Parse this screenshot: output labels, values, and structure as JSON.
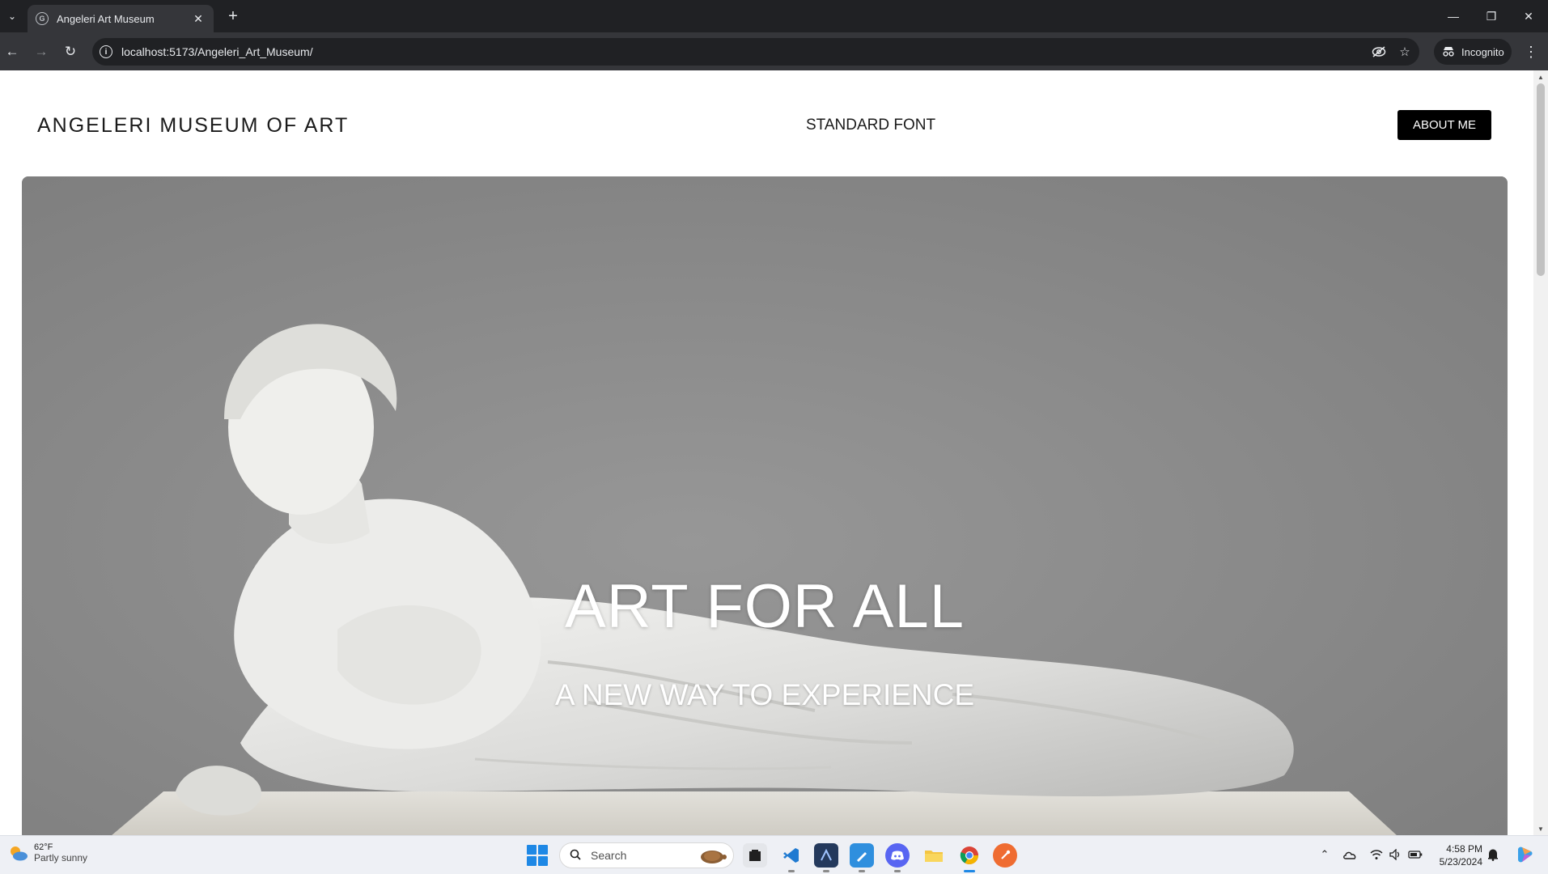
{
  "browser": {
    "tab": {
      "title": "Angeleri Art Museum",
      "close_glyph": "✕"
    },
    "new_tab_glyph": "+",
    "address": {
      "url": "localhost:5173/Angeleri_Art_Museum/"
    },
    "incognito_label": "Incognito",
    "window_controls": {
      "minimize": "—",
      "restore": "❐",
      "close": "✕"
    }
  },
  "site": {
    "brand": "ANGELERI MUSEUM OF ART",
    "font_toggle": "STANDARD FONT",
    "about_button": "ABOUT ME",
    "hero": {
      "title": "ART FOR ALL",
      "subtitle": "A NEW WAY TO EXPERIENCE"
    }
  },
  "taskbar": {
    "weather": {
      "temp": "62°F",
      "description": "Partly sunny"
    },
    "search_placeholder": "Search",
    "clock": {
      "time": "4:58 PM",
      "date": "5/23/2024"
    },
    "apps": [
      "file-manager-icon",
      "vscode-icon",
      "ssms-icon",
      "paint-icon",
      "discord-icon",
      "file-explorer-icon",
      "chrome-icon",
      "postman-icon"
    ]
  },
  "colors": {
    "browser_dark": "#202124",
    "toolbar": "#35363a",
    "accent_button": "#000000",
    "hero_bg": "#888888",
    "windows_blue": "#1e88e5"
  }
}
